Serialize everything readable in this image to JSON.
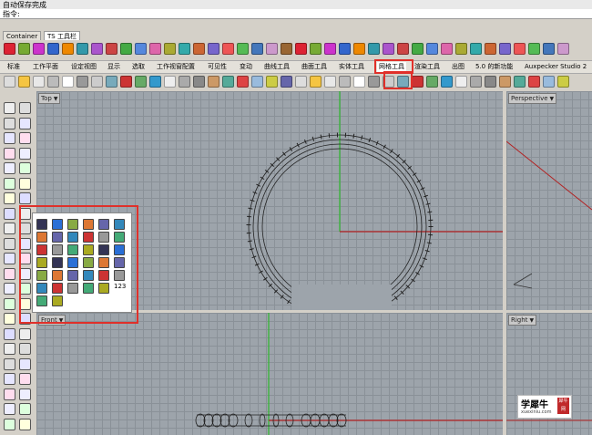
{
  "command": {
    "status": "自动保存完成",
    "prompt": "指令:"
  },
  "toolbar_tabs": [
    "Container",
    "TS 工具栏"
  ],
  "tool_tabs": [
    "标准",
    "工作平面",
    "设定视图",
    "显示",
    "选取",
    "工作视窗配置",
    "可见性",
    "变动",
    "曲线工具",
    "曲面工具",
    "实体工具",
    "网格工具",
    "渲染工具",
    "出图",
    "5.0 的新功能",
    "Auxpecker Studio 2"
  ],
  "viewports": {
    "top": "Top",
    "perspective": "Perspective",
    "front": "Front",
    "right": "Right"
  },
  "popup": {
    "label_123": "123"
  },
  "watermark": {
    "title": "学犀牛",
    "url": "xuexiniu.com",
    "seal": "犀牛网"
  },
  "colors": {
    "highlight": "#e0302a",
    "x_axis": "#b22222",
    "y_axis": "#2db82d",
    "viewport": "#9da4ab"
  }
}
